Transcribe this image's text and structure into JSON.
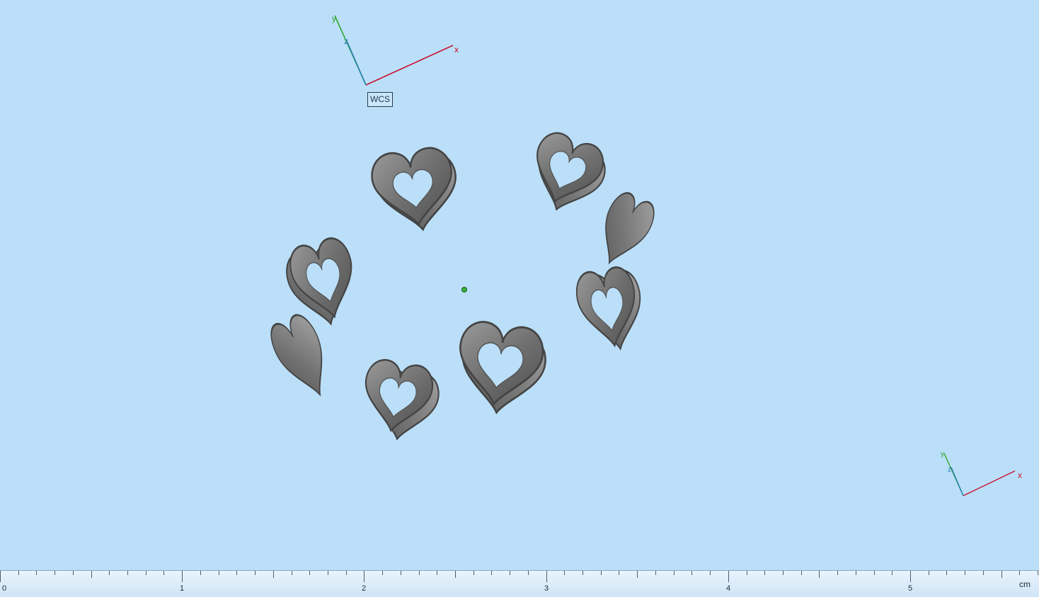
{
  "viewport": {
    "background": "#bbdff8",
    "wcs_label": "WCS",
    "axis_labels": {
      "x": "x",
      "y": "y",
      "z": "z"
    },
    "axis_colors": {
      "x": "#c8102e",
      "y": "#2ea82e",
      "z": "#2a7fb8"
    },
    "model": {
      "name": "heart-ring",
      "color": "#7c7c7c",
      "heart_count": 8
    },
    "pivot_color": "#36b336"
  },
  "ruler": {
    "ticks": [
      "0",
      "1",
      "2",
      "3",
      "4",
      "5"
    ],
    "unit": "cm"
  }
}
